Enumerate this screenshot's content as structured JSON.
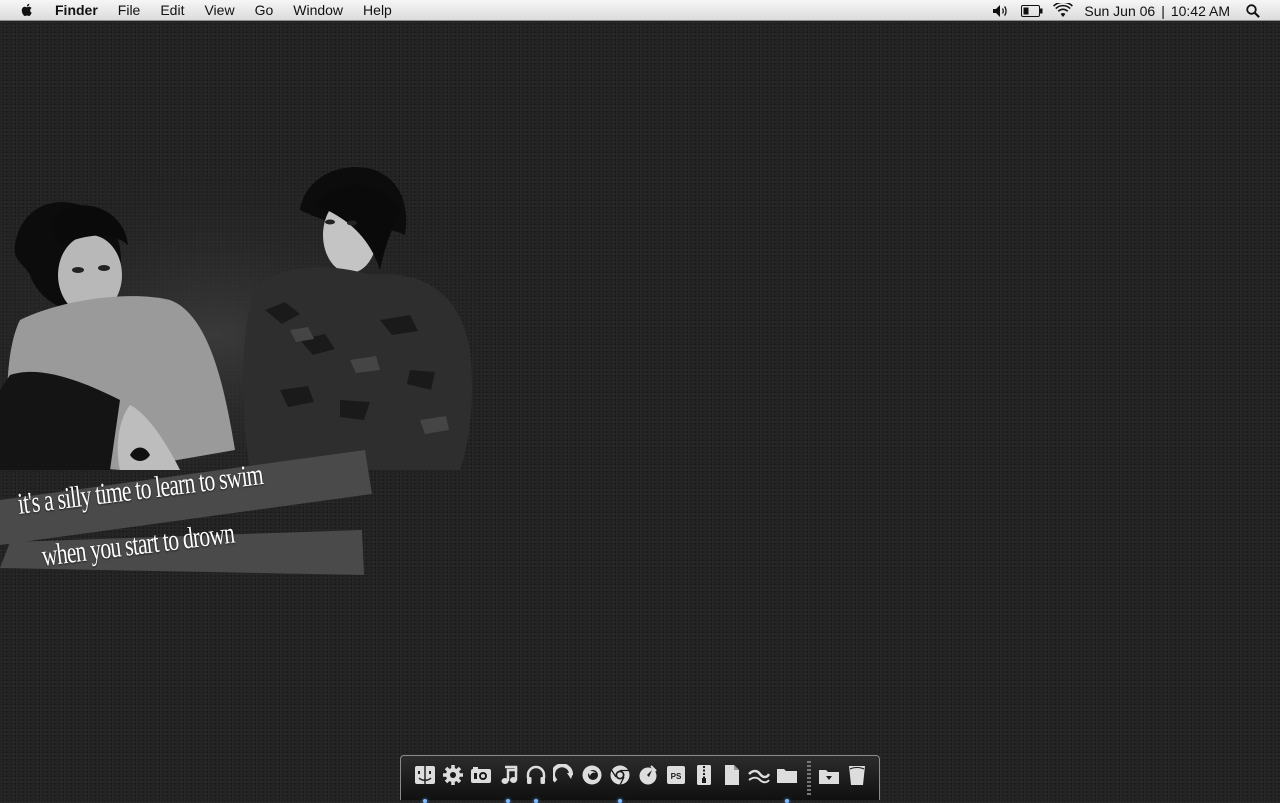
{
  "menubar": {
    "apple_icon": "apple-logo-icon",
    "app_name": "Finder",
    "menus": [
      "File",
      "Edit",
      "View",
      "Go",
      "Window",
      "Help"
    ],
    "status": {
      "volume_icon": "volume-icon",
      "battery_icon": "battery-icon",
      "wifi_icon": "wifi-icon",
      "date": "Sun Jun 06",
      "separator": "|",
      "time": "10:42 AM",
      "spotlight_icon": "spotlight-search-icon"
    }
  },
  "wallpaper": {
    "lyric_line_1": "it's a silly time to learn to swim",
    "lyric_line_2": "when you start to drown"
  },
  "dock": {
    "items": [
      {
        "icon": "finder-icon",
        "running": true
      },
      {
        "icon": "system-preferences-gear-icon",
        "running": false
      },
      {
        "icon": "camera-icon",
        "running": false
      },
      {
        "icon": "music-note-icon",
        "running": true
      },
      {
        "icon": "headphones-icon",
        "running": true
      },
      {
        "icon": "arrow-swirl-icon",
        "running": false
      },
      {
        "icon": "firefox-icon",
        "running": false
      },
      {
        "icon": "chrome-icon",
        "running": true
      },
      {
        "icon": "compass-icon",
        "running": false
      },
      {
        "icon": "photoshop-icon",
        "label": "PS",
        "running": false
      },
      {
        "icon": "archive-zipper-icon",
        "running": false
      },
      {
        "icon": "document-icon",
        "running": false
      },
      {
        "icon": "wave-icon",
        "running": false
      },
      {
        "icon": "folder-icon",
        "running": true
      },
      {
        "icon": "downloads-folder-icon",
        "running": false
      },
      {
        "icon": "trash-icon",
        "running": false
      }
    ]
  }
}
